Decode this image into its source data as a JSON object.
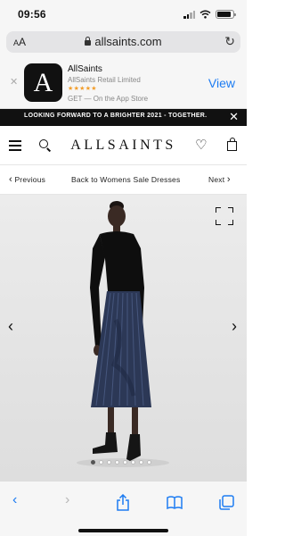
{
  "status_bar": {
    "time": "09:56",
    "battery_level": 0.9
  },
  "browser": {
    "text_size_label": "AA",
    "url": "allsaints.com"
  },
  "app_banner": {
    "app_name": "AllSaints",
    "company": "AllSaints Retail Limited",
    "stars": "★★★★★",
    "get_text": "GET — On the App Store",
    "view_label": "View",
    "icon_letter": "A"
  },
  "promo": {
    "text": "LOOKING FORWARD TO A BRIGHTER 2021 - TOGETHER."
  },
  "header": {
    "brand": "ALLSAINTS"
  },
  "breadcrumb_nav": {
    "previous_label": "Previous",
    "back_label": "Back to Womens Sale Dresses",
    "next_label": "Next"
  },
  "gallery": {
    "image_count": 8,
    "active_index": 0
  },
  "colors": {
    "accent": "#1d7cf2",
    "promo_bg": "#111111",
    "skirt": "#2c3856",
    "top": "#0e0e0e"
  },
  "icons": {
    "header": [
      "menu-icon",
      "search-icon",
      "heart-icon",
      "bag-icon"
    ],
    "toolbar": [
      "back-icon",
      "forward-icon",
      "share-icon",
      "bookmarks-icon",
      "tabs-icon"
    ]
  }
}
